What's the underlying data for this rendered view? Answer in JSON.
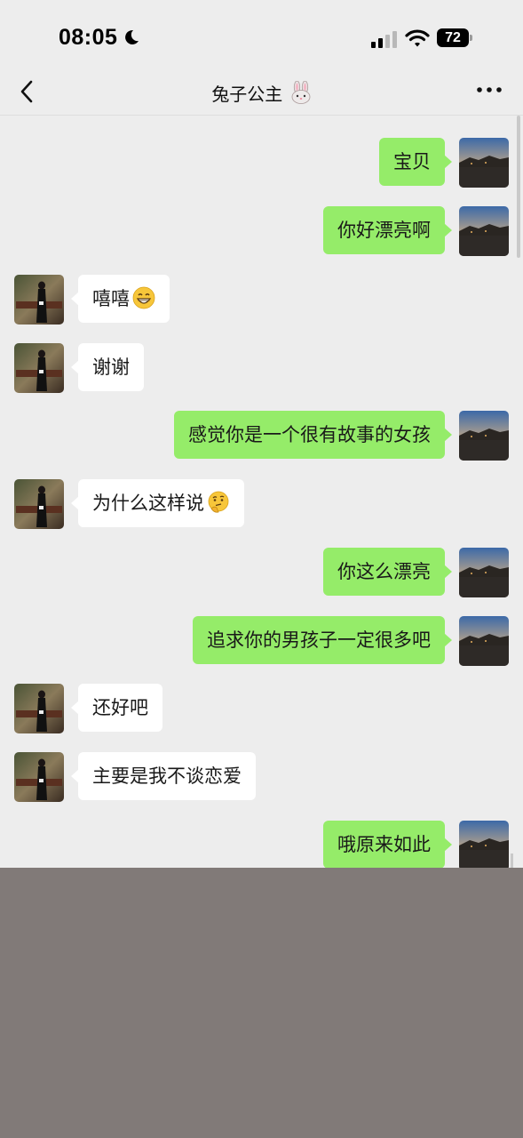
{
  "status_bar": {
    "time": "08:05",
    "battery": "72",
    "icons": [
      "moon-icon",
      "signal-icon",
      "wifi-icon",
      "battery-icon"
    ]
  },
  "nav": {
    "title": "兔子公主",
    "icons": [
      "back-icon",
      "rabbit-emoji",
      "more-icon"
    ]
  },
  "colors": {
    "background": "#ededed",
    "sent_bubble": "#95ec69",
    "received_bubble": "#ffffff",
    "bottom_area": "#817a78"
  },
  "messages": [
    {
      "from": "me",
      "text": "宝贝"
    },
    {
      "from": "me",
      "text": "你好漂亮啊"
    },
    {
      "from": "them",
      "text": "嘻嘻",
      "emoji": "grinning-emoji"
    },
    {
      "from": "them",
      "text": "谢谢"
    },
    {
      "from": "me",
      "text": "感觉你是一个很有故事的女孩"
    },
    {
      "from": "them",
      "text": "为什么这样说",
      "emoji": "thinking-emoji"
    },
    {
      "from": "me",
      "text": "你这么漂亮"
    },
    {
      "from": "me",
      "text": "追求你的男孩子一定很多吧"
    },
    {
      "from": "them",
      "text": "还好吧"
    },
    {
      "from": "them",
      "text": "主要是我不谈恋爱"
    },
    {
      "from": "me",
      "text": "哦原来如此"
    }
  ]
}
